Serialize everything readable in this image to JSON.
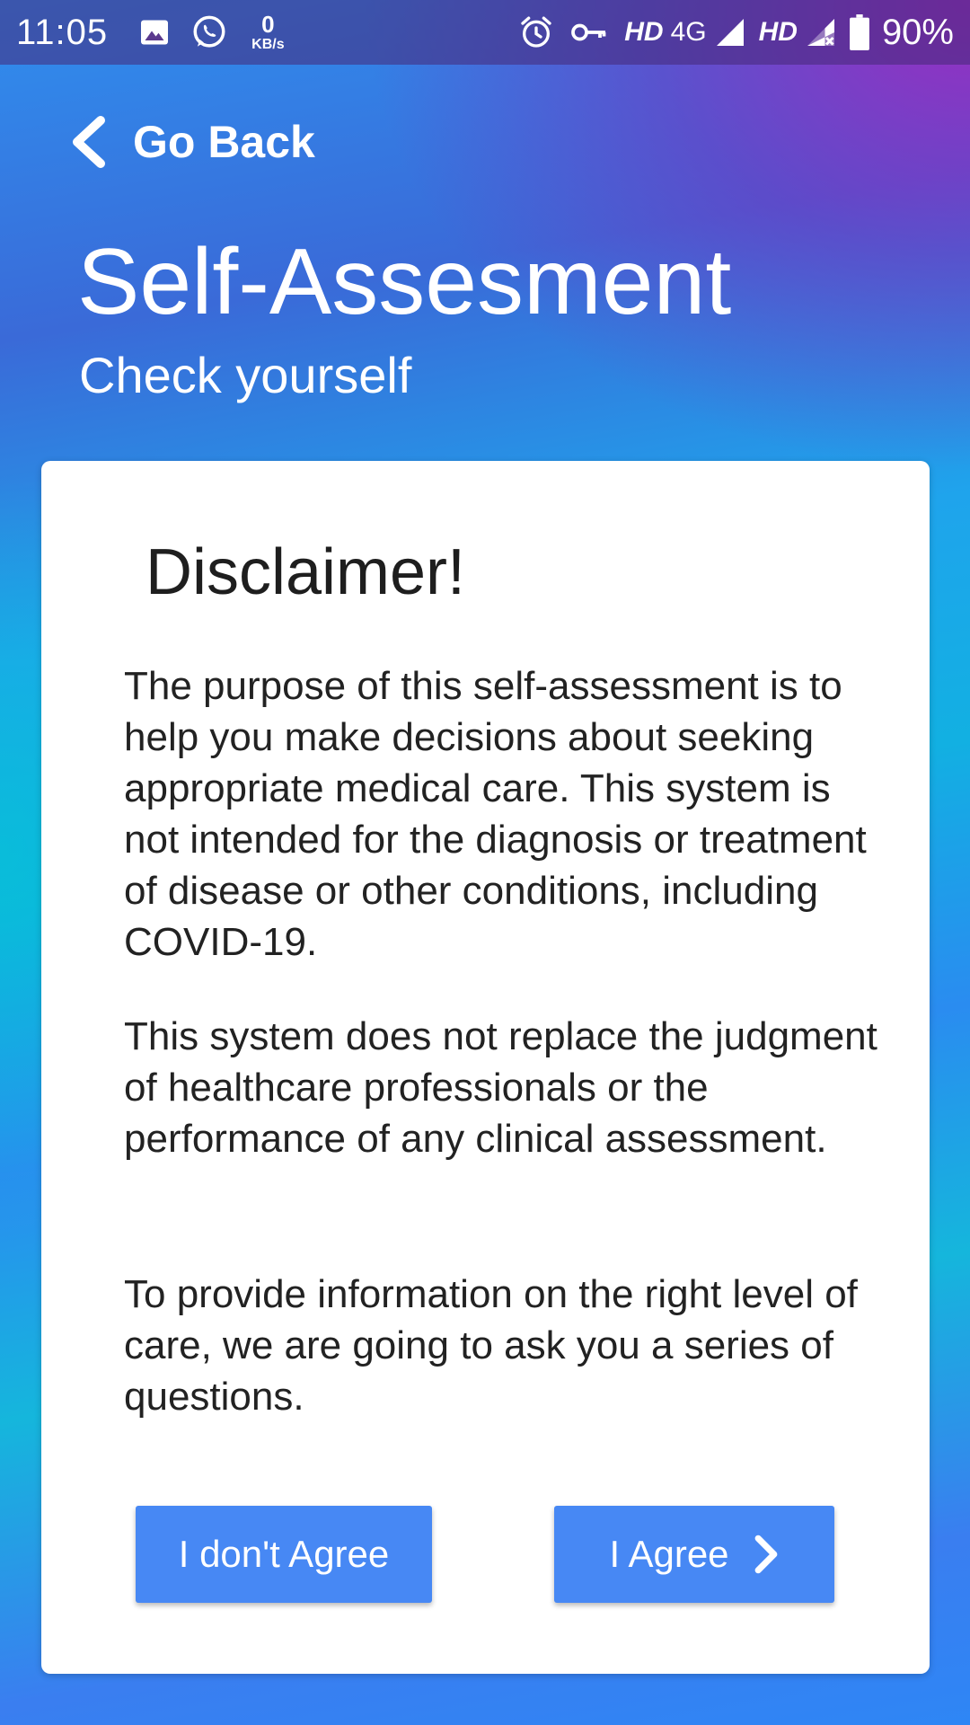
{
  "status_bar": {
    "time": "11:05",
    "data_rate_value": "0",
    "data_rate_unit": "KB/s",
    "hd_label_1": "HD",
    "network_label": "4G",
    "hd_label_2": "HD",
    "battery_percent": "90%"
  },
  "header": {
    "back_label": "Go Back",
    "title": "Self-Assesment",
    "subtitle": "Check yourself"
  },
  "disclaimer": {
    "title": "Disclaimer!",
    "paragraphs": [
      "The purpose of this self-assessment is to help you make decisions about seeking appropriate medical care. This system is not intended for the diagnosis or treatment of disease or other conditions, including COVID-19.",
      "This system does not replace the judgment of healthcare professionals or the performance of any clinical assessment.",
      "To provide information on the right level of care, we are going to ask you a series of questions."
    ],
    "disagree_label": "I don't Agree",
    "agree_label": "I Agree"
  },
  "colors": {
    "button": "#4788f4",
    "card_background": "#ffffff",
    "gradient_purple": "#9c27b0",
    "gradient_blue": "#2196f3",
    "gradient_cyan": "#00bcd4"
  },
  "icons": {
    "status_left": [
      "image-icon",
      "whatsapp-icon"
    ],
    "status_right": [
      "alarm-icon",
      "vpn-key-icon",
      "signal-icon",
      "signal-no-data-icon",
      "battery-icon"
    ],
    "back": "chevron-left-icon",
    "agree": "chevron-right-icon"
  }
}
